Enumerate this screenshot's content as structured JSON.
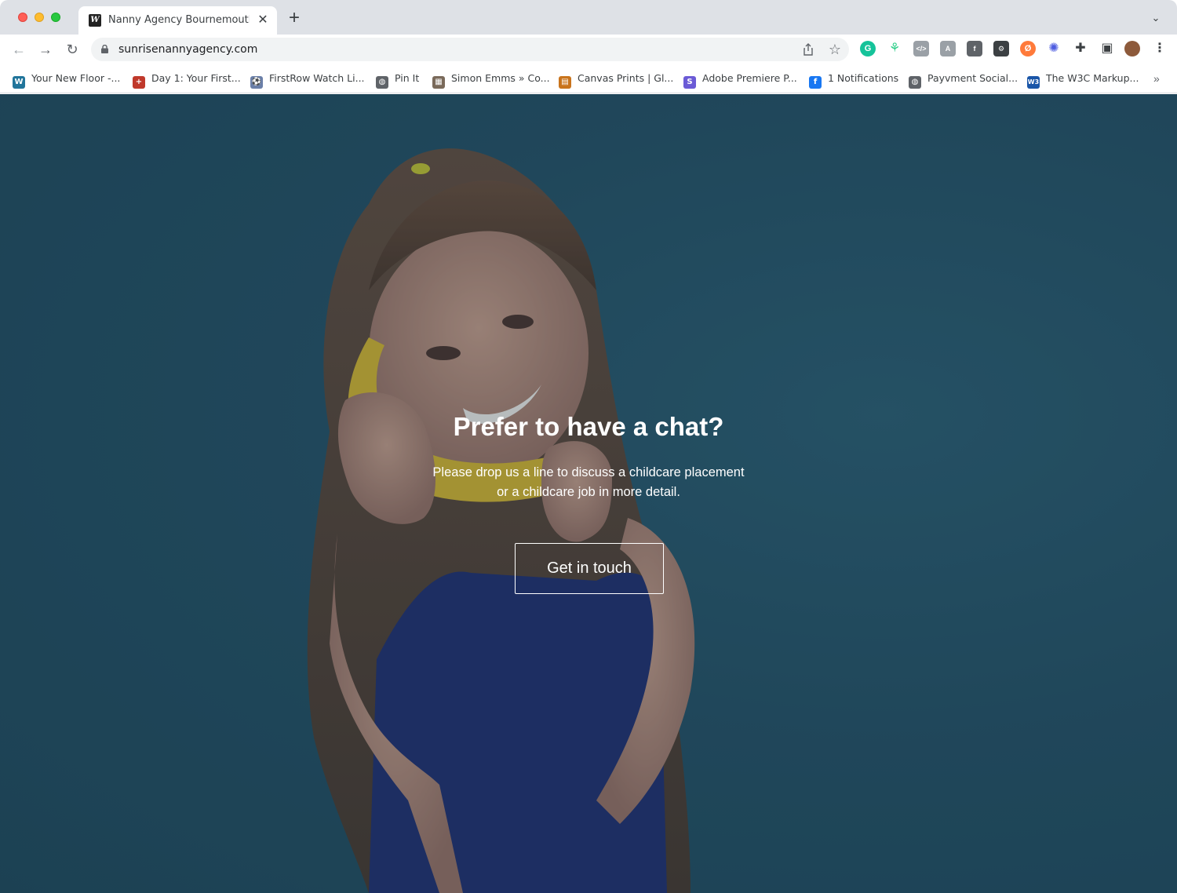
{
  "browser": {
    "tab": {
      "favicon_letter": "W",
      "title": "Nanny Agency Bournemouth | S",
      "close_glyph": "✕",
      "new_tab_glyph": "+"
    },
    "tab_search_glyph": "⌄",
    "url": "sunrisenannyagency.com",
    "nav": {
      "back": "←",
      "forward": "→",
      "reload": "↻"
    },
    "star_glyph": "☆",
    "extensions": [
      {
        "name": "grammarly-icon",
        "glyph": "G",
        "color": "#15c39a"
      },
      {
        "name": "leaf-extension-icon",
        "glyph": "⚘",
        "color": "#ffffff"
      },
      {
        "name": "code-extension-icon",
        "glyph": "</>",
        "color": "#9aa0a6"
      },
      {
        "name": "font-extension-icon",
        "glyph": "A",
        "color": "#9aa0a6"
      },
      {
        "name": "facebook-extension-icon",
        "glyph": "f",
        "color": "#5f6368"
      },
      {
        "name": "hubspot-extension-icon",
        "glyph": "⚙",
        "color": "#3c4043"
      },
      {
        "name": "orange-extension-icon",
        "glyph": "Ø",
        "color": "#ff7a3a"
      },
      {
        "name": "sparkle-extension-icon",
        "glyph": "✺",
        "color": "#4c5be0"
      },
      {
        "name": "puzzle-icon",
        "glyph": "✚",
        "color": "#3c4043"
      },
      {
        "name": "side-panel-icon",
        "glyph": "▣",
        "color": "#3c4043"
      },
      {
        "name": "profile-avatar",
        "glyph": "",
        "color": "#8d5a3b"
      },
      {
        "name": "menu-icon",
        "glyph": "⋮",
        "color": "#3c4043"
      }
    ],
    "bookmarks": [
      {
        "label": "Your New Floor -...",
        "icon": "W",
        "color": "#21759b"
      },
      {
        "label": "Day 1: Your First...",
        "icon": "+",
        "color": "#c0392b"
      },
      {
        "label": "FirstRow Watch Li...",
        "icon": "⚽",
        "color": "#6a7fa8"
      },
      {
        "label": "Pin It",
        "icon": "◍",
        "color": "#5f6368"
      },
      {
        "label": "Simon Emms » Co...",
        "icon": "▦",
        "color": "#7a6a5a"
      },
      {
        "label": "Canvas Prints | Gl...",
        "icon": "▤",
        "color": "#c9741c"
      },
      {
        "label": "Adobe Premiere P...",
        "icon": "S",
        "color": "#6b5bd6"
      },
      {
        "label": "1 Notifications",
        "icon": "f",
        "color": "#1877f2"
      },
      {
        "label": "Payvment Social...",
        "icon": "◍",
        "color": "#5f6368"
      },
      {
        "label": "The W3C Markup...",
        "icon": "W3",
        "color": "#1a56a8"
      }
    ],
    "bookmarks_more": "»"
  },
  "page": {
    "title": "Prefer to have a chat?",
    "subtitle_line1": "Please drop us a line to discuss a childcare placement",
    "subtitle_line2": "or a childcare job in more detail.",
    "cta_label": "Get in touch"
  }
}
